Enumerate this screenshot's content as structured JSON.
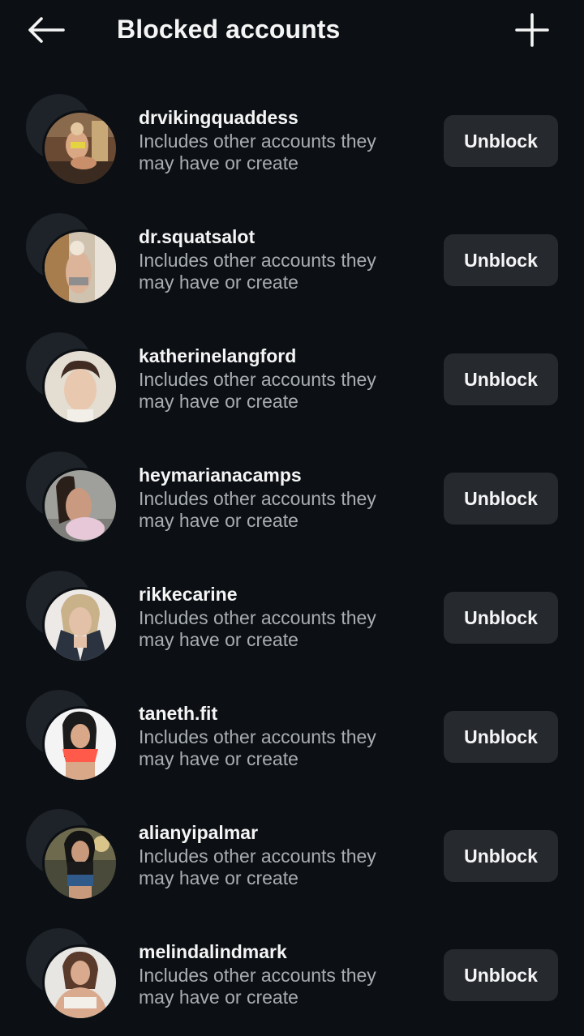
{
  "header": {
    "title": "Blocked accounts",
    "back_icon": "arrow-left-icon",
    "add_icon": "plus-icon"
  },
  "colors": {
    "background": "#0c1014",
    "button_bg": "#262a2f",
    "secondary_text": "#a8adb3"
  },
  "accounts": [
    {
      "username": "drvikingquaddess",
      "subtitle_line1": "Includes other accounts they",
      "subtitle_line2": "may have or create",
      "button_label": "Unblock"
    },
    {
      "username": "dr.squatsalot",
      "subtitle_line1": "Includes other accounts they",
      "subtitle_line2": "may have or create",
      "button_label": "Unblock"
    },
    {
      "username": "katherinelangford",
      "subtitle_line1": "Includes other accounts they",
      "subtitle_line2": "may have or create",
      "button_label": "Unblock"
    },
    {
      "username": "heymarianacamps",
      "subtitle_line1": "Includes other accounts they",
      "subtitle_line2": "may have or create",
      "button_label": "Unblock"
    },
    {
      "username": "rikkecarine",
      "subtitle_line1": "Includes other accounts they",
      "subtitle_line2": "may have or create",
      "button_label": "Unblock"
    },
    {
      "username": "taneth.fit",
      "subtitle_line1": "Includes other accounts they",
      "subtitle_line2": "may have or create",
      "button_label": "Unblock"
    },
    {
      "username": "alianyipalmar",
      "subtitle_line1": "Includes other accounts they",
      "subtitle_line2": "may have or create",
      "button_label": "Unblock"
    },
    {
      "username": "melindalindmark",
      "subtitle_line1": "Includes other accounts they",
      "subtitle_line2": "may have or create",
      "button_label": "Unblock"
    }
  ]
}
